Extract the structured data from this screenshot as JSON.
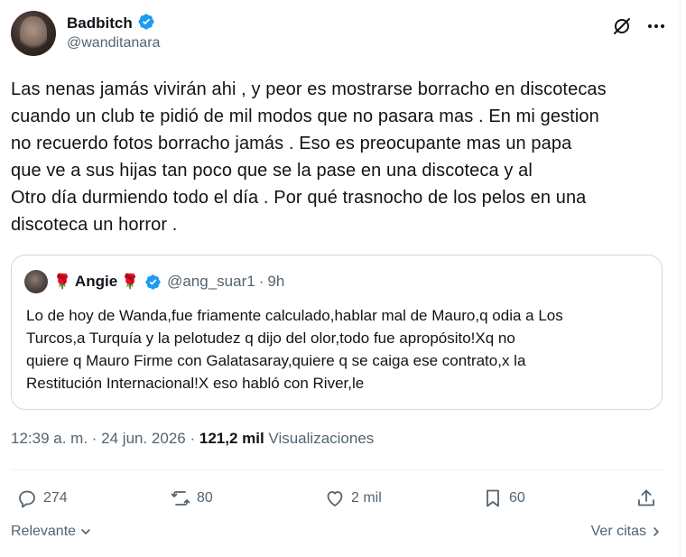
{
  "author": {
    "display_name": "Badbitch",
    "handle": "@wanditanara",
    "verified": true
  },
  "post": {
    "lines": [
      "Las nenas jamás vivirán ahi , y peor es mostrarse borracho en discotecas",
      "cuando un club te pidió de mil modos que no pasara mas . En mi gestion",
      "no recuerdo fotos borracho jamás . Eso es preocupante mas un papa",
      "que ve a sus hijas tan poco que se la pase en una discoteca y al",
      "Otro día durmiendo todo el día . Por qué trasnocho de los pelos en una",
      "discoteca un horror ."
    ]
  },
  "quote": {
    "rose_left": "🌹",
    "name": "Angie",
    "rose_right": "🌹",
    "handle": "@ang_suar1",
    "separator": "·",
    "time": "9h",
    "lines": [
      "Lo de hoy de Wanda,fue friamente calculado,hablar mal de Mauro,q odia a Los",
      "Turcos,a Turquía  y la pelotudez q dijo del olor,todo fue apropósito!Xq no",
      "quiere q Mauro Firme con Galatasaray,quiere q se caiga ese contrato,x la",
      "Restitución Internacional!X eso habló con River,le"
    ]
  },
  "meta": {
    "timestamp": "12:39 a. m. · 24 jun. 2026 ·",
    "views_count": "121,2 mil",
    "views_label": "Visualizaciones"
  },
  "actions": {
    "replies": "274",
    "reposts": "80",
    "likes": "2 mil",
    "bookmarks": "60"
  },
  "footer": {
    "sort_label": "Relevante",
    "quotes_label": "Ver citas"
  },
  "colors": {
    "text": "#0f1419",
    "secondary": "#536471",
    "verified": "#1d9bf0",
    "border": "#cfd9de"
  }
}
